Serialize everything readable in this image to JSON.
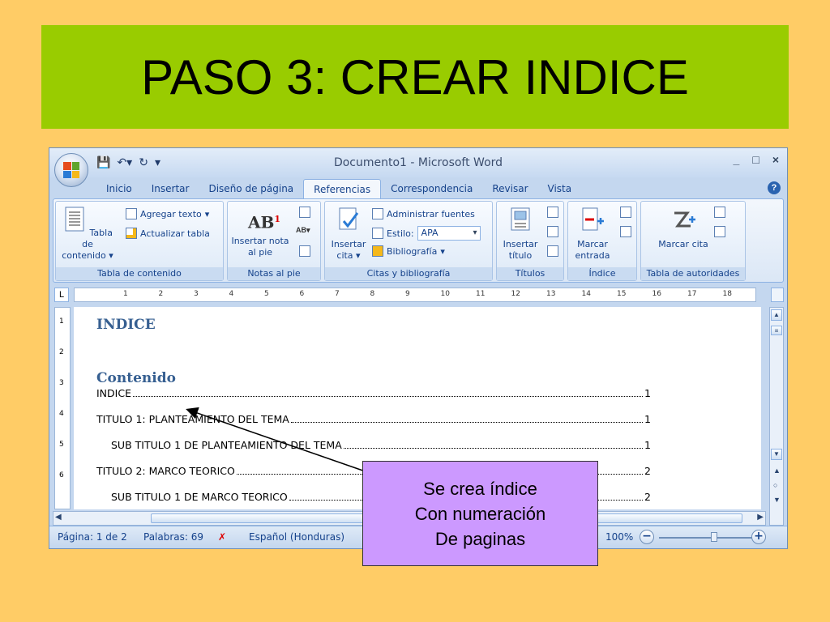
{
  "slide": {
    "title": "PASO 3: CREAR INDICE"
  },
  "window": {
    "title": "Documento1 - Microsoft Word",
    "controls": [
      "_",
      "□",
      "×"
    ]
  },
  "tabs": [
    {
      "label": "Inicio",
      "active": false
    },
    {
      "label": "Insertar",
      "active": false
    },
    {
      "label": "Diseño de página",
      "active": false
    },
    {
      "label": "Referencias",
      "active": true
    },
    {
      "label": "Correspondencia",
      "active": false
    },
    {
      "label": "Revisar",
      "active": false
    },
    {
      "label": "Vista",
      "active": false
    }
  ],
  "ribbon": {
    "toc_group": {
      "label": "Tabla de contenido",
      "big_button": "Tabla de contenido",
      "add_text": "Agregar texto",
      "update_table": "Actualizar tabla"
    },
    "footnotes_group": {
      "label": "Notas al pie",
      "big_button": "Insertar nota al pie",
      "icon_text": "AB"
    },
    "citations_group": {
      "label": "Citas y bibliografía",
      "big_button": "Insertar cita",
      "manage_sources": "Administrar fuentes",
      "style_label": "Estilo:",
      "style_value": "APA",
      "bibliography": "Bibliografía"
    },
    "captions_group": {
      "label": "Títulos",
      "big_button": "Insertar título"
    },
    "index_group": {
      "label": "Índice",
      "big_button": "Marcar entrada"
    },
    "authorities_group": {
      "label": "Tabla de autoridades",
      "big_button": "Marcar cita"
    }
  },
  "ruler": {
    "marks": [
      "1",
      "2",
      "3",
      "4",
      "5",
      "6",
      "7",
      "8",
      "9",
      "10",
      "11",
      "12",
      "13",
      "14",
      "15",
      "16",
      "17",
      "18"
    ]
  },
  "vruler": {
    "marks": [
      "1",
      "2",
      "3",
      "4",
      "5",
      "6"
    ]
  },
  "document": {
    "heading": "INDICE",
    "contents_heading": "Contenido",
    "toc": [
      {
        "text": "INDICE",
        "page": "1",
        "sub": false
      },
      {
        "text": "TITULO 1: PLANTEAMIENTO DEL TEMA",
        "page": "1",
        "sub": false
      },
      {
        "text": "SUB TITULO 1 DE PLANTEAMIENTO DEL TEMA",
        "page": "1",
        "sub": true
      },
      {
        "text": "TITULO 2: MARCO TEORICO",
        "page": "2",
        "sub": false
      },
      {
        "text": "SUB TITULO 1 DE MARCO TEORICO",
        "page": "2",
        "sub": true
      }
    ]
  },
  "statusbar": {
    "page": "Página: 1 de 2",
    "words": "Palabras: 69",
    "language": "Español (Honduras)",
    "zoom": "100%"
  },
  "callout": {
    "line1": "Se crea índice",
    "line2": "Con numeración",
    "line3": "De paginas"
  },
  "colors": {
    "slide_bg": "#ffcc66",
    "title_bg": "#99cc00",
    "callout_bg": "#cc99ff",
    "heading_blue": "#365f91"
  }
}
